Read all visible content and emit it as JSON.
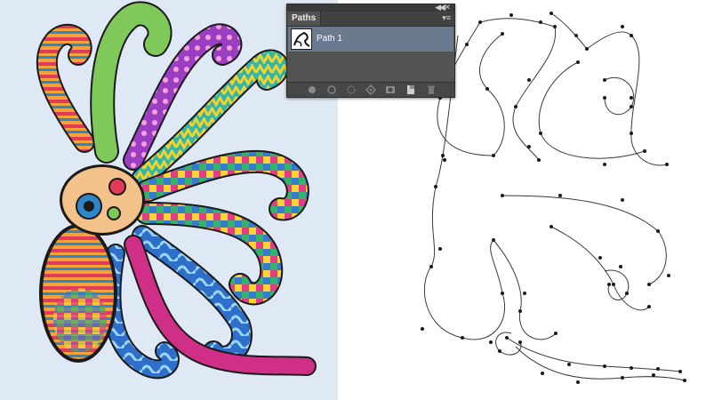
{
  "panel": {
    "tab_label": "Paths",
    "menu_icon": "panel-menu-icon",
    "collapse_icon": "collapse-double-arrow-icon",
    "paths": [
      {
        "name": "Path 1",
        "selected": true,
        "thumbnail_icon": "path-thumbnail"
      }
    ],
    "toolbar_icons": [
      "fill-path-icon",
      "stroke-path-icon",
      "load-as-selection-icon",
      "make-work-path-icon",
      "add-mask-icon",
      "new-path-icon",
      "delete-path-icon"
    ],
    "colors": {
      "panel_bg": "#535353",
      "selected_row": "#6a7a8f",
      "text": "#ffffff"
    }
  },
  "canvas": {
    "left_image": "hand-drawn-colorful-octopus-illustration",
    "right_image": "octopus-vector-path-outline-with-anchor-points"
  }
}
